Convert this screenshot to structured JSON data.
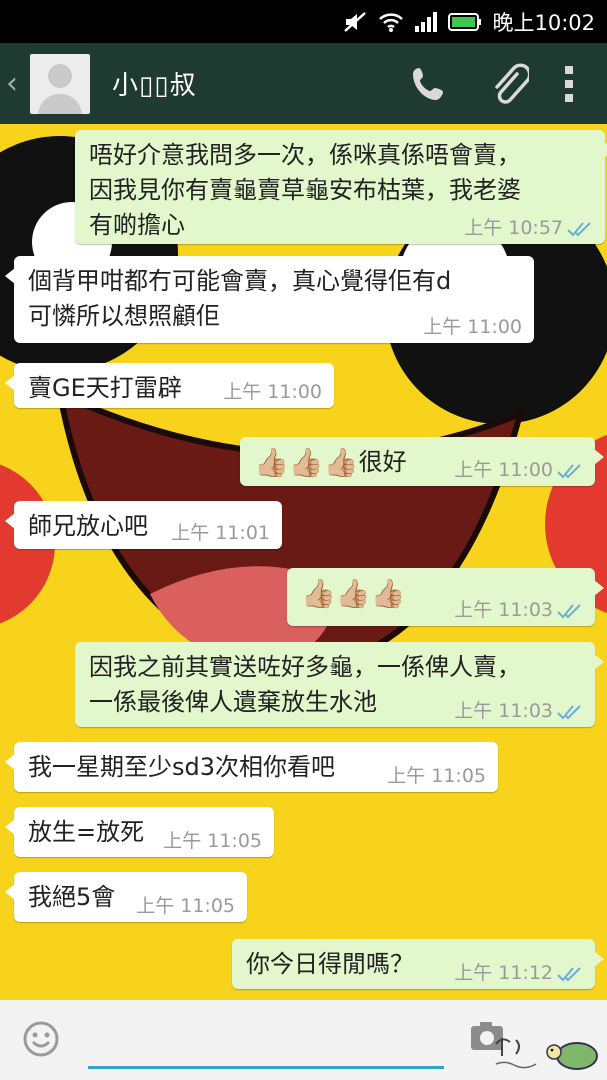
{
  "status": {
    "time": "晚上10:02"
  },
  "header": {
    "contact_name": "小▯▯叔"
  },
  "messages": [
    {
      "dir": "out",
      "lines": [
        "唔好介意我問多一次，係咪真係唔會賣，",
        "因我見你有賣龜賣草龜安布枯葉，我老婆",
        "有啲擔心"
      ],
      "time": "上午 10:57"
    },
    {
      "dir": "in",
      "lines": [
        "個背甲咁都冇可能會賣，真心覺得佢有d",
        "可憐所以想照顧佢"
      ],
      "time": "上午 11:00"
    },
    {
      "dir": "in",
      "lines": [
        "賣GE天打雷辟"
      ],
      "time": "上午 11:00"
    },
    {
      "dir": "out",
      "lines": [
        "很好"
      ],
      "time": "上午 11:00",
      "emoji": "👍🏼👍🏼👍🏼"
    },
    {
      "dir": "in",
      "lines": [
        "師兄放心吧"
      ],
      "time": "上午 11:01"
    },
    {
      "dir": "out",
      "lines": [
        ""
      ],
      "time": "上午 11:03",
      "emoji": "👍🏼👍🏼👍🏼"
    },
    {
      "dir": "out",
      "lines": [
        "因我之前其實送咗好多龜，一係俾人賣，",
        "一係最後俾人遺棄放生水池"
      ],
      "time": "上午 11:03"
    },
    {
      "dir": "in",
      "lines": [
        "我一星期至少sd3次相你看吧"
      ],
      "time": "上午 11:05"
    },
    {
      "dir": "in",
      "lines": [
        "放生=放死"
      ],
      "time": "上午 11:05"
    },
    {
      "dir": "in",
      "lines": [
        "我絕5會"
      ],
      "time": "上午 11:05"
    },
    {
      "dir": "out",
      "lines": [
        "你今日得閒嗎？"
      ],
      "time": "上午 11:12"
    }
  ],
  "input": {
    "placeholder": "",
    "value": ""
  },
  "colors": {
    "header": "#1f3a30",
    "bubble_out": "#e2f7cb",
    "bubble_in": "#ffffff",
    "tick": "#6aaed6",
    "accent": "#33a3c9",
    "wallpaper": "#f8d31c"
  }
}
